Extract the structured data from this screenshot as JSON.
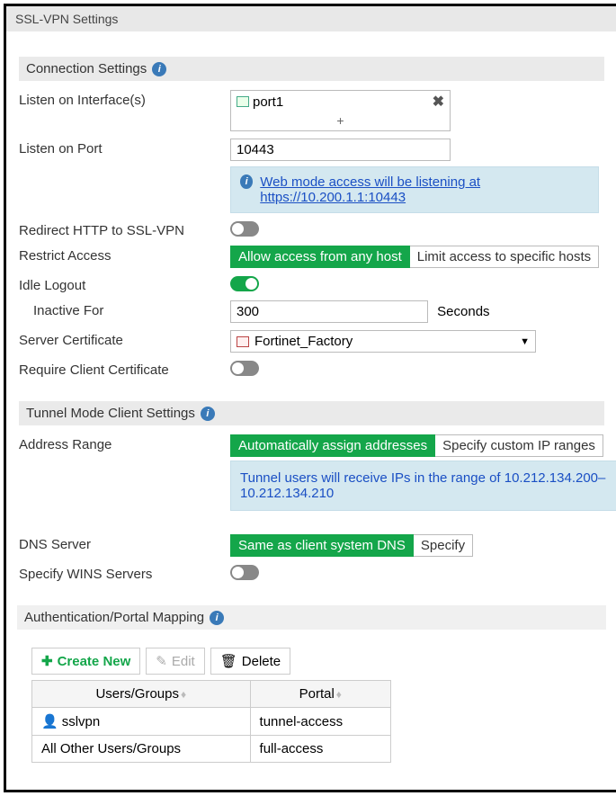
{
  "title": "SSL-VPN Settings",
  "connection": {
    "header": "Connection Settings",
    "listen_interfaces_label": "Listen on Interface(s)",
    "interface_value": "port1",
    "add_interface": "+",
    "listen_port_label": "Listen on Port",
    "listen_port_value": "10443",
    "web_notice_prefix": "Web mode access will be listening at",
    "web_notice_url": "https://10.200.1.1:10443",
    "redirect_label": "Redirect HTTP to SSL-VPN",
    "restrict_label": "Restrict Access",
    "restrict_opt_any": "Allow access from any host",
    "restrict_opt_limit": "Limit access to specific hosts",
    "idle_label": "Idle Logout",
    "inactive_label": "Inactive For",
    "inactive_value": "300",
    "inactive_unit": "Seconds",
    "server_cert_label": "Server Certificate",
    "server_cert_value": "Fortinet_Factory",
    "require_client_cert_label": "Require Client Certificate"
  },
  "tunnel": {
    "header": "Tunnel Mode Client Settings",
    "address_range_label": "Address Range",
    "addr_opt_auto": "Automatically assign addresses",
    "addr_opt_custom": "Specify custom IP ranges",
    "tunnel_notice": "Tunnel users will receive IPs in the range of 10.212.134.200–10.212.134.210",
    "dns_label": "DNS Server",
    "dns_opt_same": "Same as client system DNS",
    "dns_opt_specify": "Specify",
    "wins_label": "Specify WINS Servers"
  },
  "auth": {
    "header": "Authentication/Portal Mapping",
    "create_new": "Create New",
    "edit": "Edit",
    "delete": "Delete",
    "col_users": "Users/Groups",
    "col_portal": "Portal",
    "rows": [
      {
        "user": "sslvpn",
        "portal": "tunnel-access",
        "has_icon": true
      },
      {
        "user": "All Other Users/Groups",
        "portal": "full-access",
        "has_icon": false
      }
    ]
  }
}
